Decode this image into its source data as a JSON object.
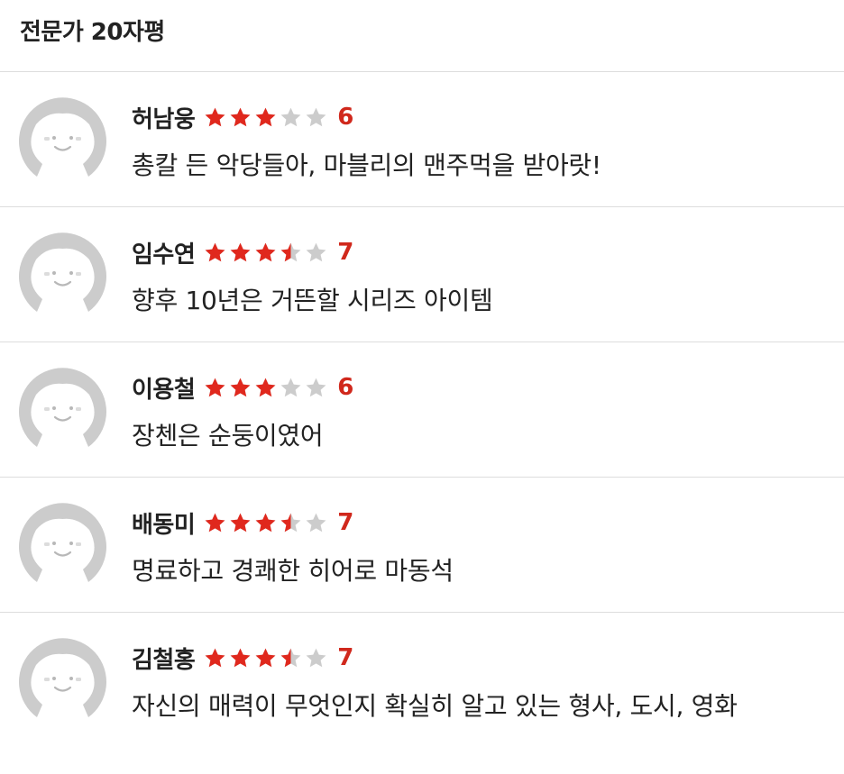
{
  "section": {
    "title": "전문가 20자평"
  },
  "colors": {
    "star_filled": "#e0281d",
    "star_empty": "#cccccc",
    "score": "#d0281c",
    "divider": "#dddddd",
    "avatar": "#cccccc"
  },
  "reviews": [
    {
      "name": "허남웅",
      "rating": 6,
      "score_label": "6",
      "text": "총칼 든 악당들아, 마블리의 맨주먹을 받아랏!",
      "avatar_icon": "default-user-icon"
    },
    {
      "name": "임수연",
      "rating": 7,
      "score_label": "7",
      "text": "향후 10년은 거뜬할 시리즈 아이템",
      "avatar_icon": "default-user-icon"
    },
    {
      "name": "이용철",
      "rating": 6,
      "score_label": "6",
      "text": "장첸은 순둥이였어",
      "avatar_icon": "default-user-icon"
    },
    {
      "name": "배동미",
      "rating": 7,
      "score_label": "7",
      "text": "명료하고 경쾌한 히어로 마동석",
      "avatar_icon": "default-user-icon"
    },
    {
      "name": "김철홍",
      "rating": 7,
      "score_label": "7",
      "text": "자신의 매력이 무엇인지 확실히 알고 있는 형사, 도시, 영화",
      "avatar_icon": "default-user-icon"
    }
  ]
}
